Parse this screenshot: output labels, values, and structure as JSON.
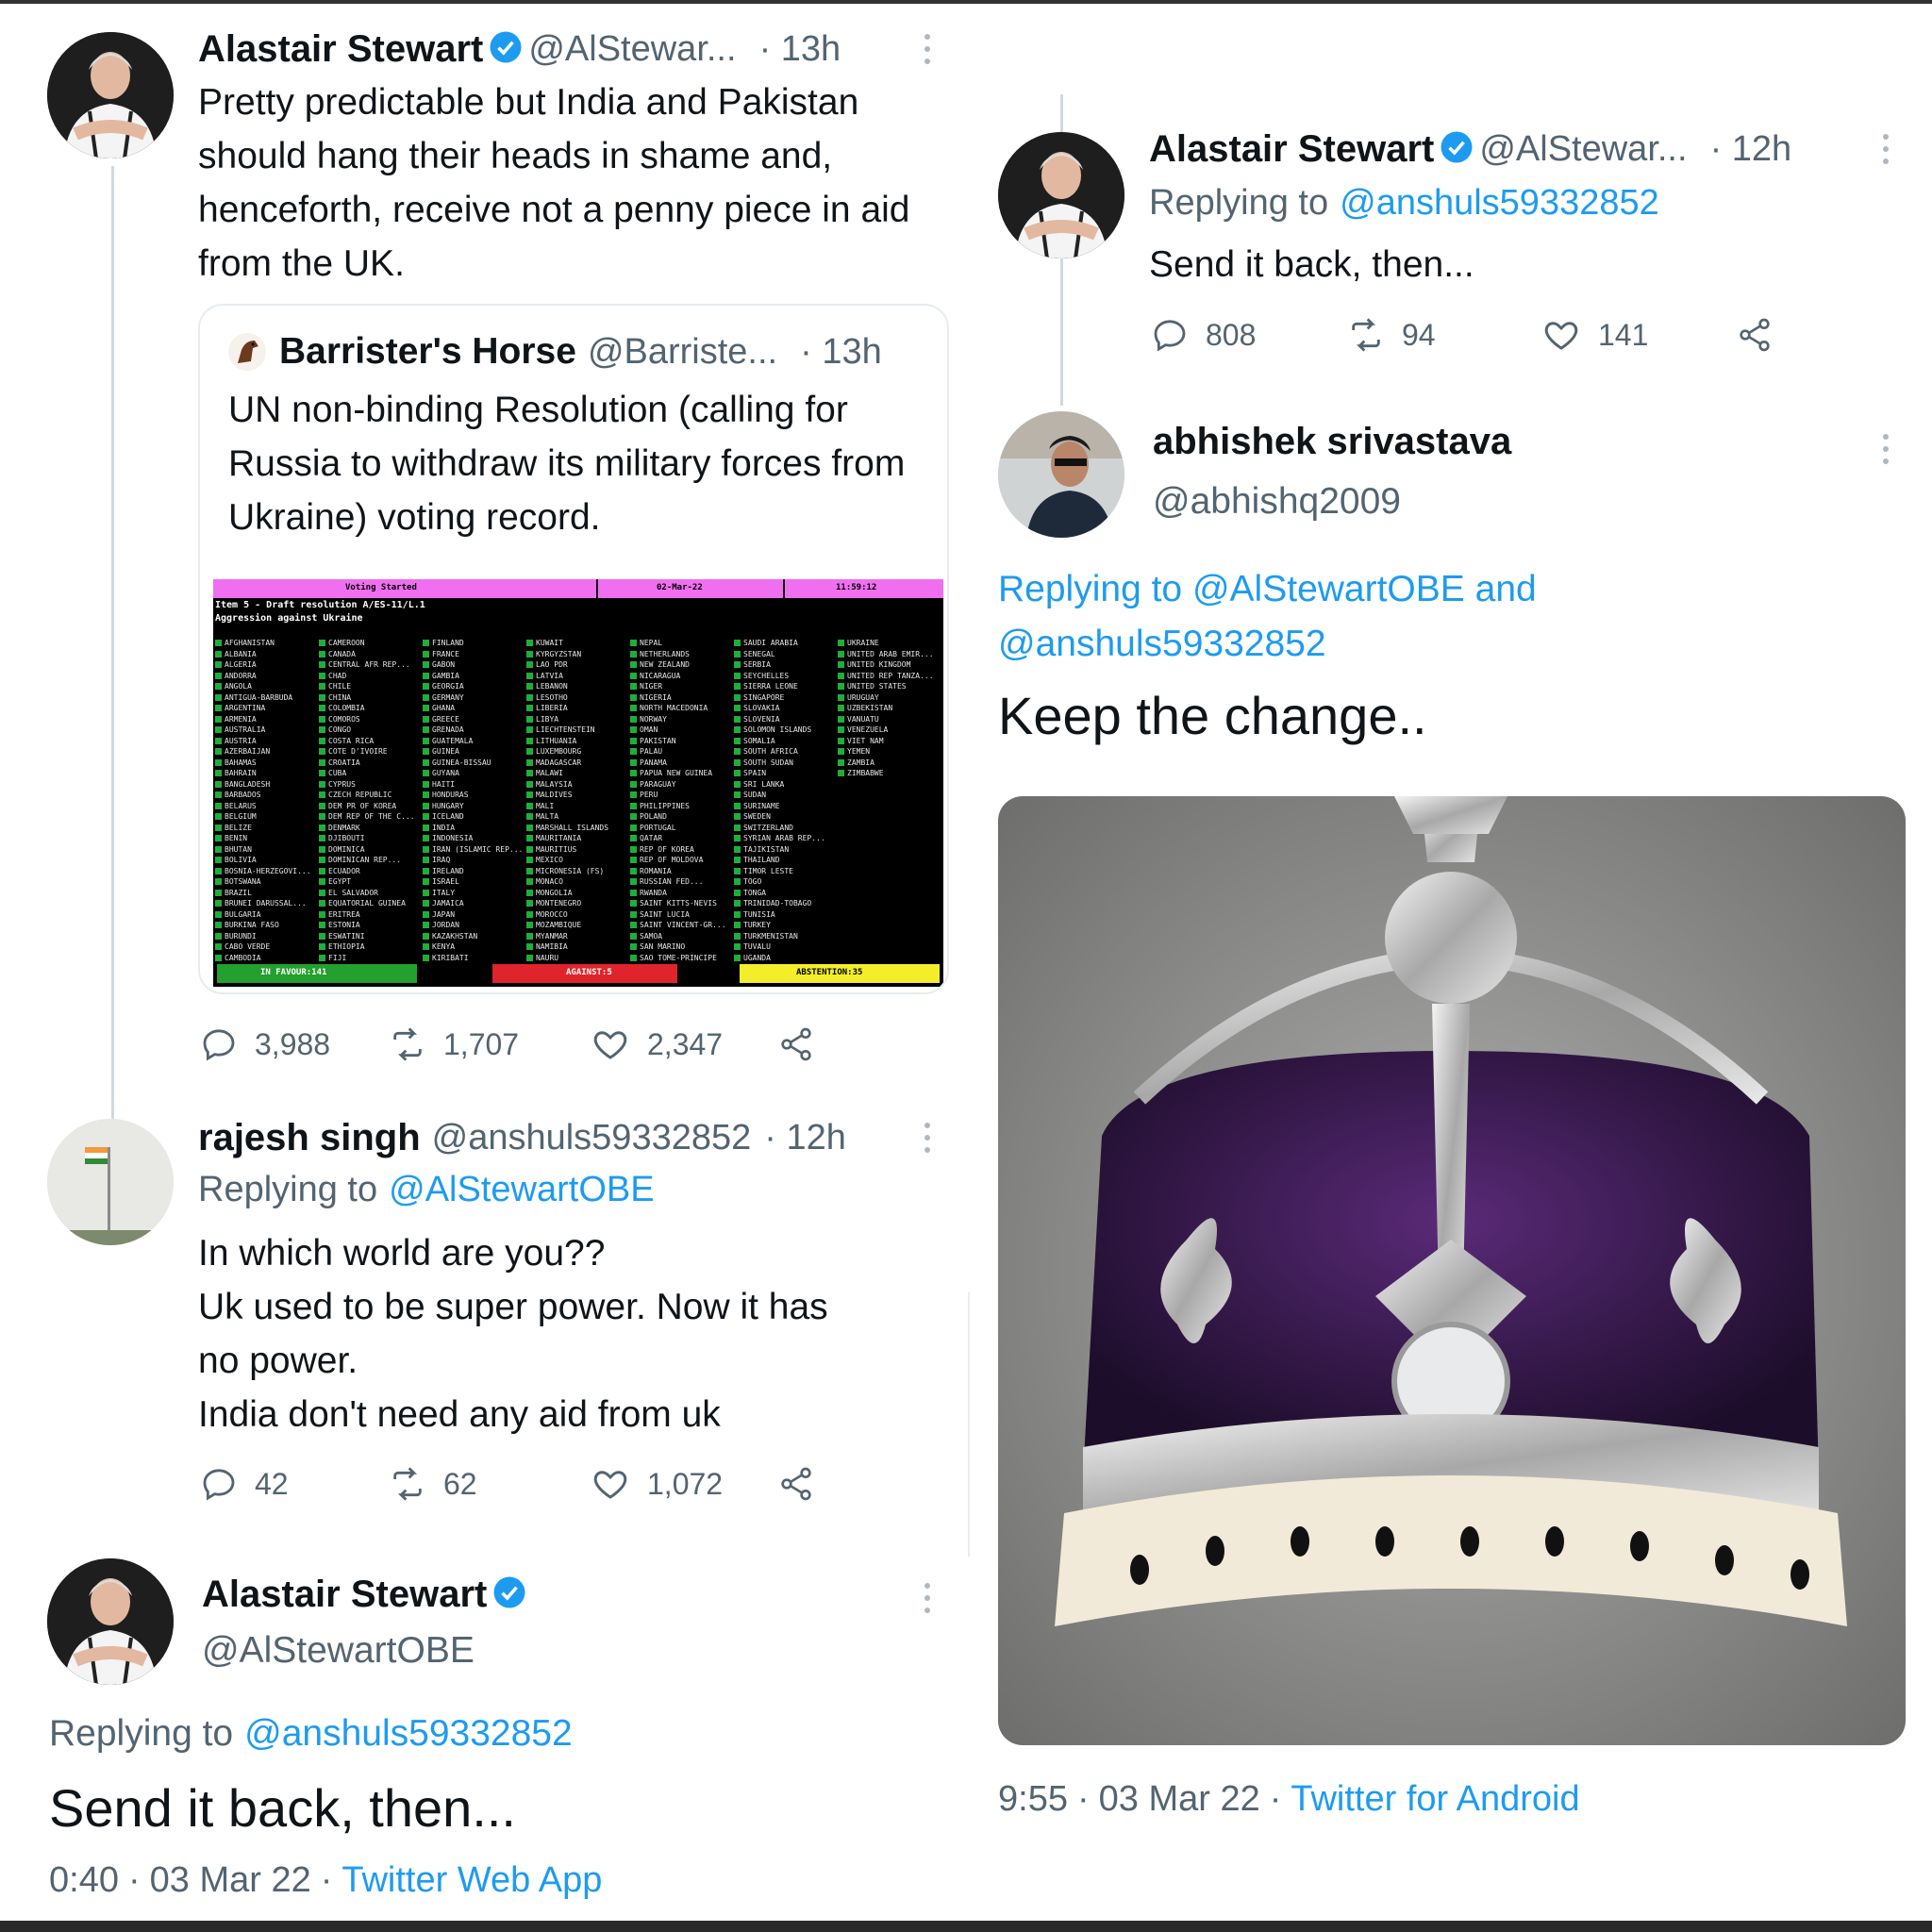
{
  "tweet1": {
    "name": "Alastair Stewart",
    "handle": "@AlStewar...",
    "time": "· 13h",
    "text": "Pretty predictable but India and Pakistan should hang their heads in shame and, henceforth, receive not a penny piece in aid from the UK.",
    "quote": {
      "name": "Barrister's Horse",
      "handle": "@Barriste...",
      "time": "· 13h",
      "text": "UN non-binding Resolution (calling for Russia to withdraw its military forces from Ukraine) voting record.",
      "board": {
        "voting_started": "Voting Started",
        "date": "02-Mar-22",
        "clock": "11:59:12",
        "item_line1": "Item 5 - Draft resolution A/ES-11/L.1",
        "item_line2": "Aggression against Ukraine",
        "in_favour": "IN FAVOUR:141",
        "against": "AGAINST:5",
        "abstention": "ABSTENTION:35",
        "col1": [
          "AFGHANISTAN",
          "ALBANIA",
          "ALGERIA",
          "ANDORRA",
          "ANGOLA",
          "ANTIGUA-BARBUDA",
          "ARGENTINA",
          "ARMENIA",
          "AUSTRALIA",
          "AUSTRIA",
          "AZERBAIJAN",
          "BAHAMAS",
          "BAHRAIN",
          "BANGLADESH",
          "BARBADOS",
          "BELARUS",
          "BELGIUM",
          "BELIZE",
          "BENIN",
          "BHUTAN",
          "BOLIVIA",
          "BOSNIA-HERZEGOVI...",
          "BOTSWANA",
          "BRAZIL",
          "BRUNEI DARUSSAL...",
          "BULGARIA",
          "BURKINA FASO",
          "BURUNDI",
          "CABO VERDE",
          "CAMBODIA"
        ],
        "col2": [
          "CAMEROON",
          "CANADA",
          "CENTRAL AFR REP...",
          "CHAD",
          "CHILE",
          "CHINA",
          "COLOMBIA",
          "COMOROS",
          "CONGO",
          "COSTA RICA",
          "COTE D'IVOIRE",
          "CROATIA",
          "CUBA",
          "CYPRUS",
          "CZECH REPUBLIC",
          "DEM PR OF KOREA",
          "DEM REP OF THE C...",
          "DENMARK",
          "DJIBOUTI",
          "DOMINICA",
          "DOMINICAN REP...",
          "ECUADOR",
          "EGYPT",
          "EL SALVADOR",
          "EQUATORIAL GUINEA",
          "ERITREA",
          "ESTONIA",
          "ESWATINI",
          "ETHIOPIA",
          "FIJI"
        ],
        "col3": [
          "FINLAND",
          "FRANCE",
          "GABON",
          "GAMBIA",
          "GEORGIA",
          "GERMANY",
          "GHANA",
          "GREECE",
          "GRENADA",
          "GUATEMALA",
          "GUINEA",
          "GUINEA-BISSAU",
          "GUYANA",
          "HAITI",
          "HONDURAS",
          "HUNGARY",
          "ICELAND",
          "INDIA",
          "INDONESIA",
          "IRAN (ISLAMIC REP...",
          "IRAQ",
          "IRELAND",
          "ISRAEL",
          "ITALY",
          "JAMAICA",
          "JAPAN",
          "JORDAN",
          "KAZAKHSTAN",
          "KENYA",
          "KIRIBATI"
        ],
        "col4": [
          "KUWAIT",
          "KYRGYZSTAN",
          "LAO PDR",
          "LATVIA",
          "LEBANON",
          "LESOTHO",
          "LIBERIA",
          "LIBYA",
          "LIECHTENSTEIN",
          "LITHUANIA",
          "LUXEMBOURG",
          "MADAGASCAR",
          "MALAWI",
          "MALAYSIA",
          "MALDIVES",
          "MALI",
          "MALTA",
          "MARSHALL ISLANDS",
          "MAURITANIA",
          "MAURITIUS",
          "MEXICO",
          "MICRONESIA (FS)",
          "MONACO",
          "MONGOLIA",
          "MONTENEGRO",
          "MOROCCO",
          "MOZAMBIQUE",
          "MYANMAR",
          "NAMIBIA",
          "NAURU"
        ],
        "col5": [
          "NEPAL",
          "NETHERLANDS",
          "NEW ZEALAND",
          "NICARAGUA",
          "NIGER",
          "NIGERIA",
          "NORTH MACEDONIA",
          "NORWAY",
          "OMAN",
          "PAKISTAN",
          "PALAU",
          "PANAMA",
          "PAPUA NEW GUINEA",
          "PARAGUAY",
          "PERU",
          "PHILIPPINES",
          "POLAND",
          "PORTUGAL",
          "QATAR",
          "REP OF KOREA",
          "REP OF MOLDOVA",
          "ROMANIA",
          "RUSSIAN FED...",
          "RWANDA",
          "SAINT KITTS-NEVIS",
          "SAINT LUCIA",
          "SAINT VINCENT-GR...",
          "SAMOA",
          "SAN MARINO",
          "SAO TOME-PRINCIPE"
        ],
        "col6": [
          "SAUDI ARABIA",
          "SENEGAL",
          "SERBIA",
          "SEYCHELLES",
          "SIERRA LEONE",
          "SINGAPORE",
          "SLOVAKIA",
          "SLOVENIA",
          "SOLOMON ISLANDS",
          "SOMALIA",
          "SOUTH AFRICA",
          "SOUTH SUDAN",
          "SPAIN",
          "SRI LANKA",
          "SUDAN",
          "SURINAME",
          "SWEDEN",
          "SWITZERLAND",
          "SYRIAN ARAB REP...",
          "TAJIKISTAN",
          "THAILAND",
          "TIMOR LESTE",
          "TOGO",
          "TONGA",
          "TRINIDAD-TOBAGO",
          "TUNISIA",
          "TURKEY",
          "TURKMENISTAN",
          "TUVALU",
          "UGANDA"
        ],
        "col7": [
          "UKRAINE",
          "UNITED ARAB EMIR...",
          "UNITED KINGDOM",
          "UNITED REP TANZA...",
          "UNITED STATES",
          "URUGUAY",
          "UZBEKISTAN",
          "VANUATU",
          "VENEZUELA",
          "VIET NAM",
          "YEMEN",
          "ZAMBIA",
          "ZIMBABWE"
        ]
      }
    },
    "stats": {
      "replies": "3,988",
      "retweets": "1,707",
      "likes": "2,347"
    }
  },
  "tweet2": {
    "name": "rajesh singh",
    "handle": "@anshuls59332852",
    "time": "· 12h",
    "replying_prefix": "Replying to",
    "replying_to": "@AlStewartOBE",
    "lines": [
      "In which world are you??",
      "Uk used to be super power. Now it has",
      "no power.",
      "India don't need any aid from uk"
    ],
    "stats": {
      "replies": "42",
      "retweets": "62",
      "likes": "1,072"
    }
  },
  "tweet3": {
    "name": "Alastair Stewart",
    "handle": "@AlStewartOBE",
    "replying_prefix": "Replying to",
    "replying_to": "@anshuls59332852",
    "text": "Send it back, then...",
    "time": "0:40",
    "date": "03 Mar 22",
    "source": "Twitter Web App"
  },
  "tweet4": {
    "name": "Alastair Stewart",
    "handle": "@AlStewar...",
    "time": "· 12h",
    "replying_prefix": "Replying to",
    "replying_to": "@anshuls59332852",
    "text": "Send it back, then...",
    "stats": {
      "replies": "808",
      "retweets": "94",
      "likes": "141"
    }
  },
  "tweet5": {
    "name": "abhishek srivastava",
    "handle": "@abhishq2009",
    "replying_line1": "Replying to @AlStewartOBE and",
    "replying_line2": "@anshuls59332852",
    "text": "Keep the change..",
    "time": "9:55",
    "date": "03 Mar 22",
    "source": "Twitter for Android"
  },
  "colors": {
    "link": "#1d9bf0",
    "muted": "#536471",
    "text": "#0f1419",
    "verified": "#1d9bf0"
  },
  "icons": [
    "reply-icon",
    "retweet-icon",
    "like-icon",
    "share-icon",
    "verified-badge-icon",
    "more-icon"
  ]
}
